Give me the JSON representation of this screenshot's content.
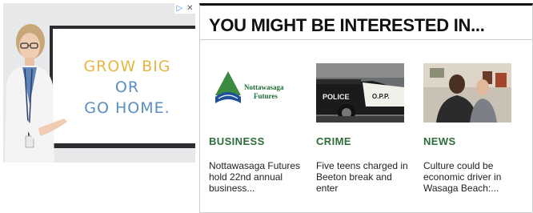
{
  "ad": {
    "headline_line1": "GROW BIG",
    "headline_line2": "OR",
    "headline_line3": "GO HOME.",
    "adchoices_icon": "adchoices-icon",
    "close_icon": "close-icon",
    "colors": {
      "gold": "#e8b544",
      "blue": "#5a8fc0"
    }
  },
  "widget": {
    "title": "YOU MIGHT BE INTERESTED IN...",
    "items": [
      {
        "category": "BUSINESS",
        "headline": "Nottawasaga Futures hold 22nd annual business...",
        "logo_line1": "Nottawasaga",
        "logo_line2": "Futures"
      },
      {
        "category": "CRIME",
        "headline": "Five teens charged in Beeton break and enter",
        "car_label": "POLICE",
        "car_badge": "O.P.P."
      },
      {
        "category": "NEWS",
        "headline": "Culture could be economic driver in Wasaga Beach:..."
      }
    ],
    "colors": {
      "category": "#2e6c3a"
    }
  }
}
